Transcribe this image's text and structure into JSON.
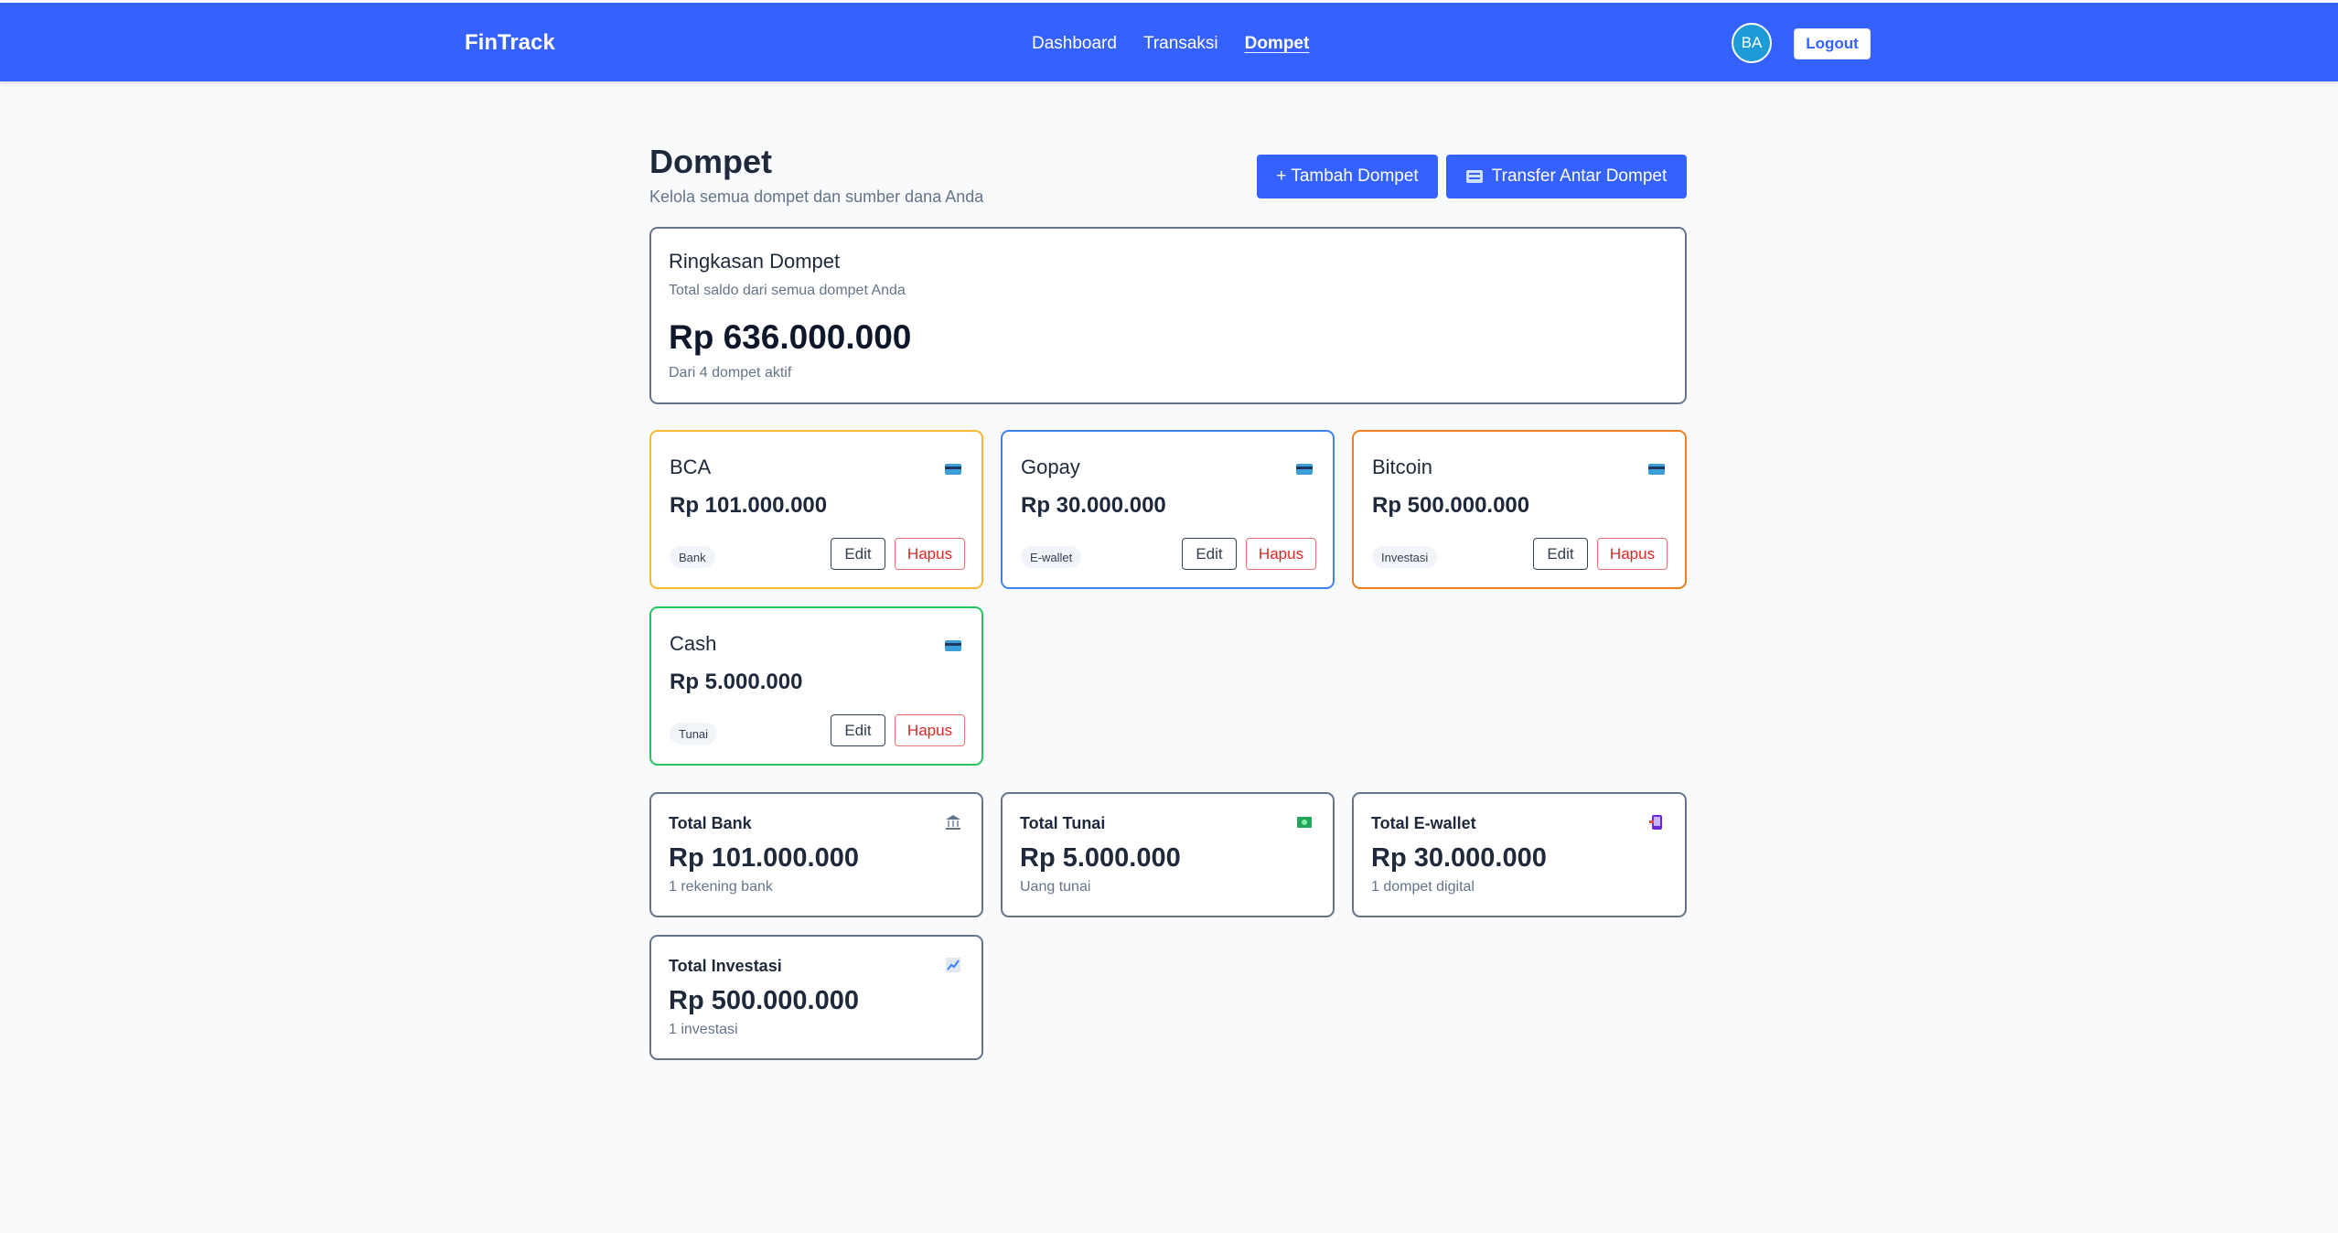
{
  "header": {
    "brand": "FinTrack",
    "nav": [
      {
        "label": "Dashboard"
      },
      {
        "label": "Transaksi"
      },
      {
        "label": "Dompet"
      }
    ],
    "avatar_initials": "BA",
    "logout_label": "Logout"
  },
  "page": {
    "title": "Dompet",
    "subtitle": "Kelola semua dompet dan sumber dana Anda",
    "add_wallet_label": "+ Tambah Dompet",
    "transfer_label": "Transfer Antar Dompet"
  },
  "summary": {
    "title": "Ringkasan Dompet",
    "subtitle": "Total saldo dari semua dompet Anda",
    "amount": "Rp 636.000.000",
    "note": "Dari 4 dompet aktif"
  },
  "wallets": [
    {
      "name": "BCA",
      "amount": "Rp 101.000.000",
      "type": "Bank",
      "border_color": "#f5b82e",
      "icon": "credit-card-icon",
      "edit_label": "Edit",
      "delete_label": "Hapus"
    },
    {
      "name": "Gopay",
      "amount": "Rp 30.000.000",
      "type": "E-wallet",
      "border_color": "#3b82f6",
      "icon": "credit-card-icon",
      "edit_label": "Edit",
      "delete_label": "Hapus"
    },
    {
      "name": "Bitcoin",
      "amount": "Rp 500.000.000",
      "type": "Investasi",
      "border_color": "#f07f1b",
      "icon": "credit-card-icon",
      "edit_label": "Edit",
      "delete_label": "Hapus"
    },
    {
      "name": "Cash",
      "amount": "Rp 5.000.000",
      "type": "Tunai",
      "border_color": "#22c55e",
      "icon": "credit-card-icon",
      "edit_label": "Edit",
      "delete_label": "Hapus"
    }
  ],
  "stats": [
    {
      "title": "Total Bank",
      "amount": "Rp 101.000.000",
      "note": "1 rekening bank",
      "icon": "bank-icon"
    },
    {
      "title": "Total Tunai",
      "amount": "Rp 5.000.000",
      "note": "Uang tunai",
      "icon": "cash-icon"
    },
    {
      "title": "Total E-wallet",
      "amount": "Rp 30.000.000",
      "note": "1 dompet digital",
      "icon": "phone-icon"
    },
    {
      "title": "Total Investasi",
      "amount": "Rp 500.000.000",
      "note": "1 investasi",
      "icon": "chart-up-icon"
    }
  ],
  "colors": {
    "primary": "#3461ff",
    "background": "#f8fafc",
    "danger": "#dc2626"
  }
}
